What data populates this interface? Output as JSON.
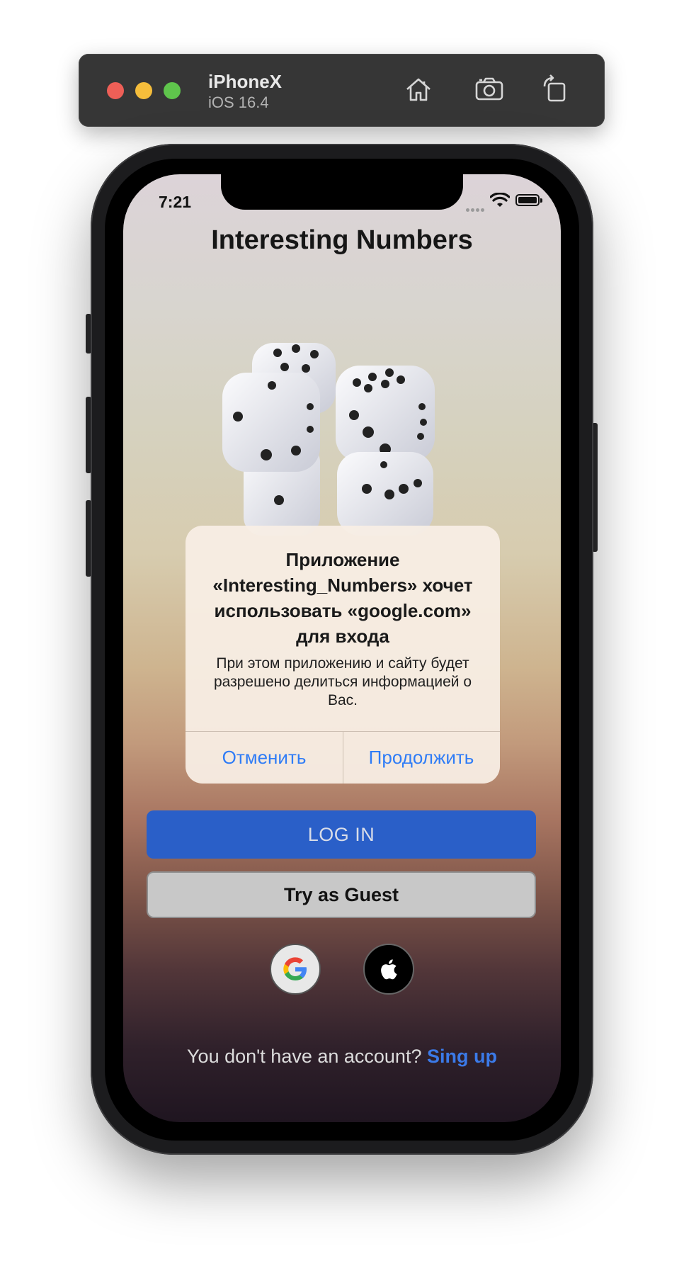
{
  "simulator": {
    "device_name": "iPhoneX",
    "os_version": "iOS 16.4",
    "toolbar_icons": [
      "home-icon",
      "screenshot-icon",
      "rotate-icon"
    ]
  },
  "status_bar": {
    "time": "7:21",
    "icons": [
      "cellular-icon",
      "wifi-icon",
      "battery-icon"
    ]
  },
  "app": {
    "title": "Interesting Numbers",
    "hero_image": "dice-illustration"
  },
  "alert": {
    "title": "Приложение «Interesting_Numbers» хочет использовать «google.com» для входа",
    "message": "При этом приложению и сайту будет разрешено делиться информацией о Вас.",
    "cancel_label": "Отменить",
    "continue_label": "Продолжить"
  },
  "buttons": {
    "login_label": "LOG IN",
    "guest_label": "Try as Guest",
    "social": [
      "google-icon",
      "apple-icon"
    ]
  },
  "signup": {
    "prompt": "You don't have an account?",
    "link_label": "Sing up"
  },
  "colors": {
    "primary": "#2a5fc8",
    "link": "#3b7ae8",
    "alert_button": "#2f7cf6"
  }
}
